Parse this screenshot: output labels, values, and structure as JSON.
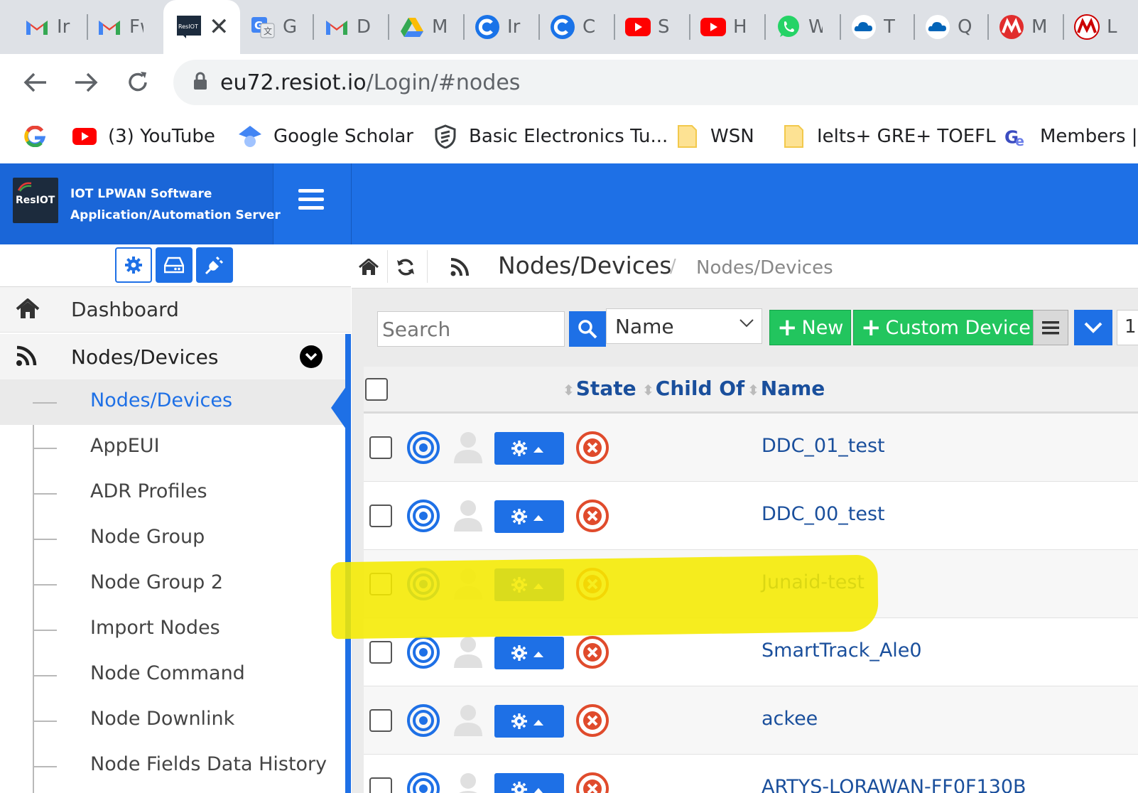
{
  "browser": {
    "tabs": [
      {
        "icon": "gmail-icon",
        "title": "Ir"
      },
      {
        "icon": "gmail-icon",
        "title": "Fw"
      },
      {
        "icon": "resiot-icon",
        "title": "ResIOT",
        "active": true
      },
      {
        "icon": "translate-icon",
        "title": "G"
      },
      {
        "icon": "gmail-icon",
        "title": "D"
      },
      {
        "icon": "drive-icon",
        "title": "M"
      },
      {
        "icon": "c-icon",
        "title": "Ir"
      },
      {
        "icon": "c-icon",
        "title": "C"
      },
      {
        "icon": "youtube-icon",
        "title": "S"
      },
      {
        "icon": "youtube-icon",
        "title": "H"
      },
      {
        "icon": "whatsapp-icon",
        "title": "W"
      },
      {
        "icon": "cloud-icon",
        "title": "T"
      },
      {
        "icon": "cloud-icon",
        "title": "Q"
      },
      {
        "icon": "microchip-icon",
        "title": "M"
      },
      {
        "icon": "microchip-icon",
        "title": "L"
      }
    ],
    "url_host": "eu72.resiot.io",
    "url_path": "/Login/#nodes",
    "bookmarks": [
      {
        "icon": "google-icon",
        "label": ""
      },
      {
        "icon": "youtube-icon",
        "label": "(3) YouTube"
      },
      {
        "icon": "scholar-icon",
        "label": "Google Scholar"
      },
      {
        "icon": "shield-icon",
        "label": "Basic Electronics Tu..."
      },
      {
        "icon": "folder-icon",
        "label": "WSN"
      },
      {
        "icon": "folder-icon",
        "label": "Ielts+ GRE+ TOEFL"
      },
      {
        "icon": "gte-icon",
        "label": "Members |"
      }
    ],
    "tab_logo_text": "ResIOT"
  },
  "app": {
    "logo_text": "ResIOT",
    "header_line1": "IOT LPWAN Software",
    "header_line2": "Application/Automation Server",
    "accent": "#1e70e6"
  },
  "sidebar": {
    "dashboard": "Dashboard",
    "nodes": "Nodes/Devices",
    "sub_items": [
      "Nodes/Devices",
      "AppEUI",
      "ADR Profiles",
      "Node Group",
      "Node Group 2",
      "Import Nodes",
      "Node Command",
      "Node Downlink",
      "Node Fields Data History"
    ]
  },
  "main": {
    "breadcrumb_title": "Nodes/Devices",
    "breadcrumb_sep": "/",
    "breadcrumb_sub": "Nodes/Devices",
    "search_placeholder": "Search",
    "select_value": "Name",
    "new_label": "New",
    "custom_device_label": "Custom Device",
    "page_size": "1"
  },
  "table": {
    "columns": [
      "State",
      "Child Of",
      "Name"
    ],
    "rows": [
      {
        "name": "DDC_01_test"
      },
      {
        "name": "DDC_00_test"
      },
      {
        "name": "Junaid-test",
        "highlighted": true
      },
      {
        "name": "SmartTrack_Ale0"
      },
      {
        "name": "ackee"
      },
      {
        "name": "ARTYS-LORAWAN-FF0F130B"
      }
    ]
  },
  "highlight_color": "#f5eb00"
}
